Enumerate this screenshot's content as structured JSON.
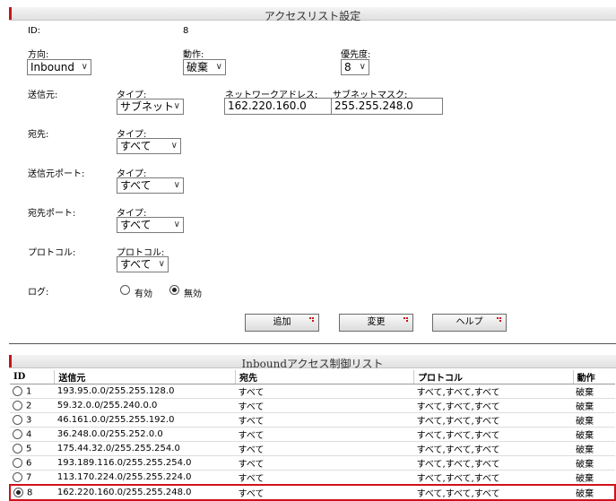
{
  "header1": {
    "title": "アクセスリスト設定"
  },
  "form": {
    "id_label": "ID:",
    "id_value": "8",
    "direction_label": "方向:",
    "direction_value": "Inbound",
    "action_label": "動作:",
    "action_value": "破棄",
    "priority_label": "優先度:",
    "priority_value": "8",
    "source_label": "送信元:",
    "type_label": "タイプ:",
    "source_type_value": "サブネット",
    "network_address_label": "ネットワークアドレス:",
    "network_address_value": "162.220.160.0",
    "subnet_mask_label": "サブネットマスク:",
    "subnet_mask_value": "255.255.248.0",
    "destination_label": "宛先:",
    "destination_type_value": "すべて",
    "source_port_label": "送信元ポート:",
    "source_port_type_value": "すべて",
    "dest_port_label": "宛先ポート:",
    "dest_port_type_value": "すべて",
    "protocol_label": "プロトコル:",
    "protocol_sub_label": "プロトコル:",
    "protocol_value": "すべて",
    "log_label": "ログ:",
    "log_enabled_label": "有効",
    "log_disabled_label": "無効",
    "log_selected": "無効"
  },
  "buttons": {
    "add": "追加",
    "change": "変更",
    "help": "ヘルプ"
  },
  "header2": {
    "title": "Inboundアクセス制御リスト"
  },
  "table": {
    "columns": [
      "ID",
      "送信元",
      "宛先",
      "プロトコル",
      "動作"
    ],
    "rows": [
      {
        "id": "1",
        "source": "193.95.0.0/255.255.128.0",
        "dest": "すべて",
        "protocol": "すべて,すべて,すべて",
        "action": "破棄"
      },
      {
        "id": "2",
        "source": "59.32.0.0/255.240.0.0",
        "dest": "すべて",
        "protocol": "すべて,すべて,すべて",
        "action": "破棄"
      },
      {
        "id": "3",
        "source": "46.161.0.0/255.255.192.0",
        "dest": "すべて",
        "protocol": "すべて,すべて,すべて",
        "action": "破棄"
      },
      {
        "id": "4",
        "source": "36.248.0.0/255.252.0.0",
        "dest": "すべて",
        "protocol": "すべて,すべて,すべて",
        "action": "破棄"
      },
      {
        "id": "5",
        "source": "175.44.32.0/255.255.254.0",
        "dest": "すべて",
        "protocol": "すべて,すべて,すべて",
        "action": "破棄"
      },
      {
        "id": "6",
        "source": "193.189.116.0/255.255.254.0",
        "dest": "すべて",
        "protocol": "すべて,すべて,すべて",
        "action": "破棄"
      },
      {
        "id": "7",
        "source": "113.170.224.0/255.255.224.0",
        "dest": "すべて",
        "protocol": "すべて,すべて,すべて",
        "action": "破棄"
      },
      {
        "id": "8",
        "source": "162.220.160.0/255.255.248.0",
        "dest": "すべて",
        "protocol": "すべて,すべて,すべて",
        "action": "破棄"
      }
    ],
    "selected_id": "8"
  }
}
